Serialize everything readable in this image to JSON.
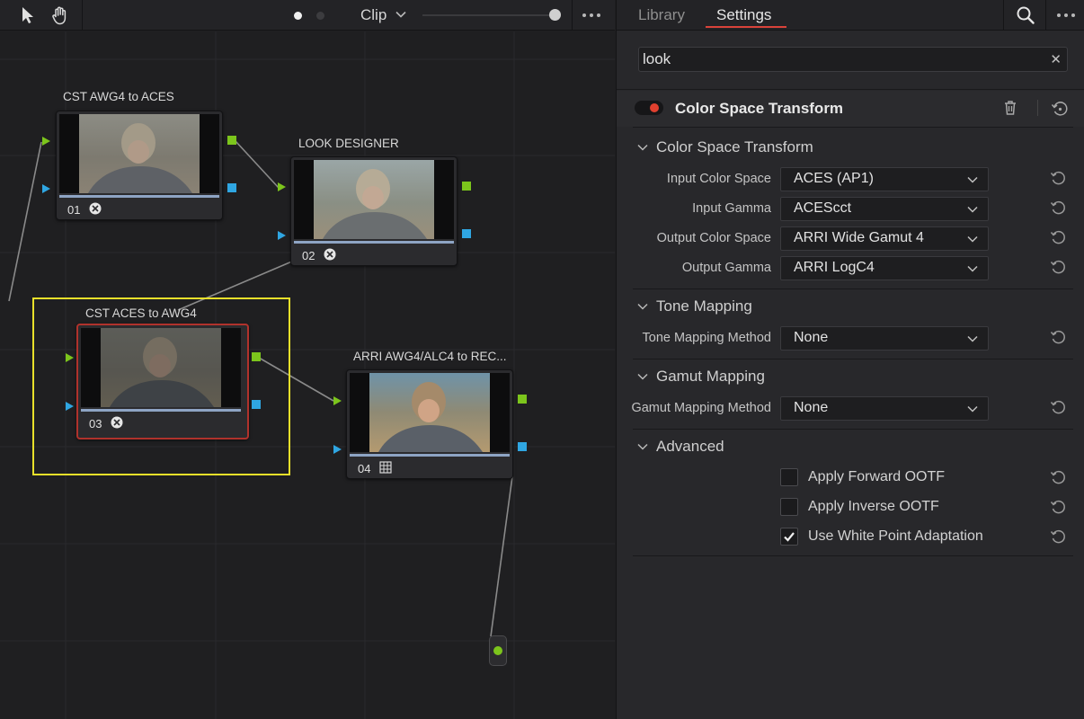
{
  "node_editor": {
    "toolbar": {
      "pointer_tool": "arrow-pointer-icon",
      "hand_tool": "hand-pan-icon",
      "clip_label": "Clip"
    },
    "nodes": [
      {
        "title": "CST AWG4 to ACES",
        "number": "01",
        "icon": "color-space-transform-icon"
      },
      {
        "title": "LOOK DESIGNER",
        "number": "02",
        "icon": "color-space-transform-icon"
      },
      {
        "title": "CST ACES to AWG4",
        "number": "03",
        "icon": "color-space-transform-icon"
      },
      {
        "title": "ARRI AWG4/ALC4 to REC...",
        "number": "04",
        "icon": "lut-grid-icon"
      }
    ]
  },
  "settings": {
    "tabs": {
      "library": "Library",
      "settings": "Settings"
    },
    "search": {
      "value": "look",
      "clear": "✕"
    },
    "effect": {
      "title": "Color Space Transform",
      "sections": {
        "cst": "Color Space Transform",
        "tone": "Tone Mapping",
        "gamut": "Gamut Mapping",
        "advanced": "Advanced"
      },
      "params": {
        "input_color_space": {
          "label": "Input Color Space",
          "value": "ACES (AP1)"
        },
        "input_gamma": {
          "label": "Input Gamma",
          "value": "ACEScct"
        },
        "output_color_space": {
          "label": "Output Color Space",
          "value": "ARRI Wide Gamut 4"
        },
        "output_gamma": {
          "label": "Output Gamma",
          "value": "ARRI LogC4"
        },
        "tone_mapping_method": {
          "label": "Tone Mapping Method",
          "value": "None"
        },
        "gamut_mapping_method": {
          "label": "Gamut Mapping Method",
          "value": "None"
        }
      },
      "checkboxes": {
        "forward_ootf": {
          "label": "Apply Forward OOTF",
          "checked": false
        },
        "inverse_ootf": {
          "label": "Apply Inverse OOTF",
          "checked": false
        },
        "white_point": {
          "label": "Use White Point Adaptation",
          "checked": true
        }
      }
    }
  },
  "colors": {
    "accent_red": "#d9423a",
    "port_green": "#7cc51c",
    "port_blue": "#2fa6e2",
    "selection_yellow": "#e8e02a"
  }
}
